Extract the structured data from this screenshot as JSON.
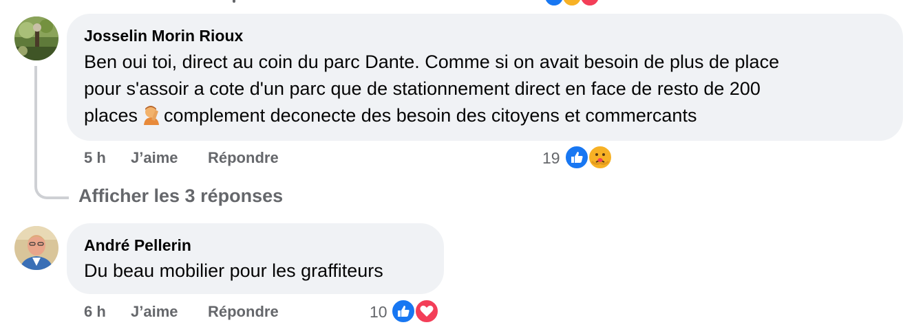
{
  "comments": [
    {
      "author": "Josselin Morin Rioux",
      "text_line1": "Ben oui toi, direct au coin du parc Dante. Comme si on avait besoin de plus de place",
      "text_line2": "pour s'assoir a cote d'un parc que de stationnement direct en face de resto de 200",
      "text_line3_before": "places",
      "text_line3_after": "complement deconecte des besoin des citoyens et commercants",
      "emoji": "facepalm-emoji",
      "time": "5 h",
      "like_label": "J’aime",
      "reply_label": "Répondre",
      "reaction_count": "19",
      "reactions": [
        "like",
        "care"
      ]
    },
    {
      "author": "André Pellerin",
      "text": "Du beau mobilier pour les graffiteurs",
      "time": "6 h",
      "like_label": "J’aime",
      "reply_label": "Répondre",
      "reaction_count": "10",
      "reactions": [
        "like",
        "love"
      ]
    }
  ],
  "view_replies": "Afficher les 3 réponses",
  "colors": {
    "bubble": "#f0f2f5",
    "meta_text": "#65676b",
    "like_blue": "#1877f2",
    "love_red": "#f33e58",
    "care_yellow": "#f7b125"
  }
}
